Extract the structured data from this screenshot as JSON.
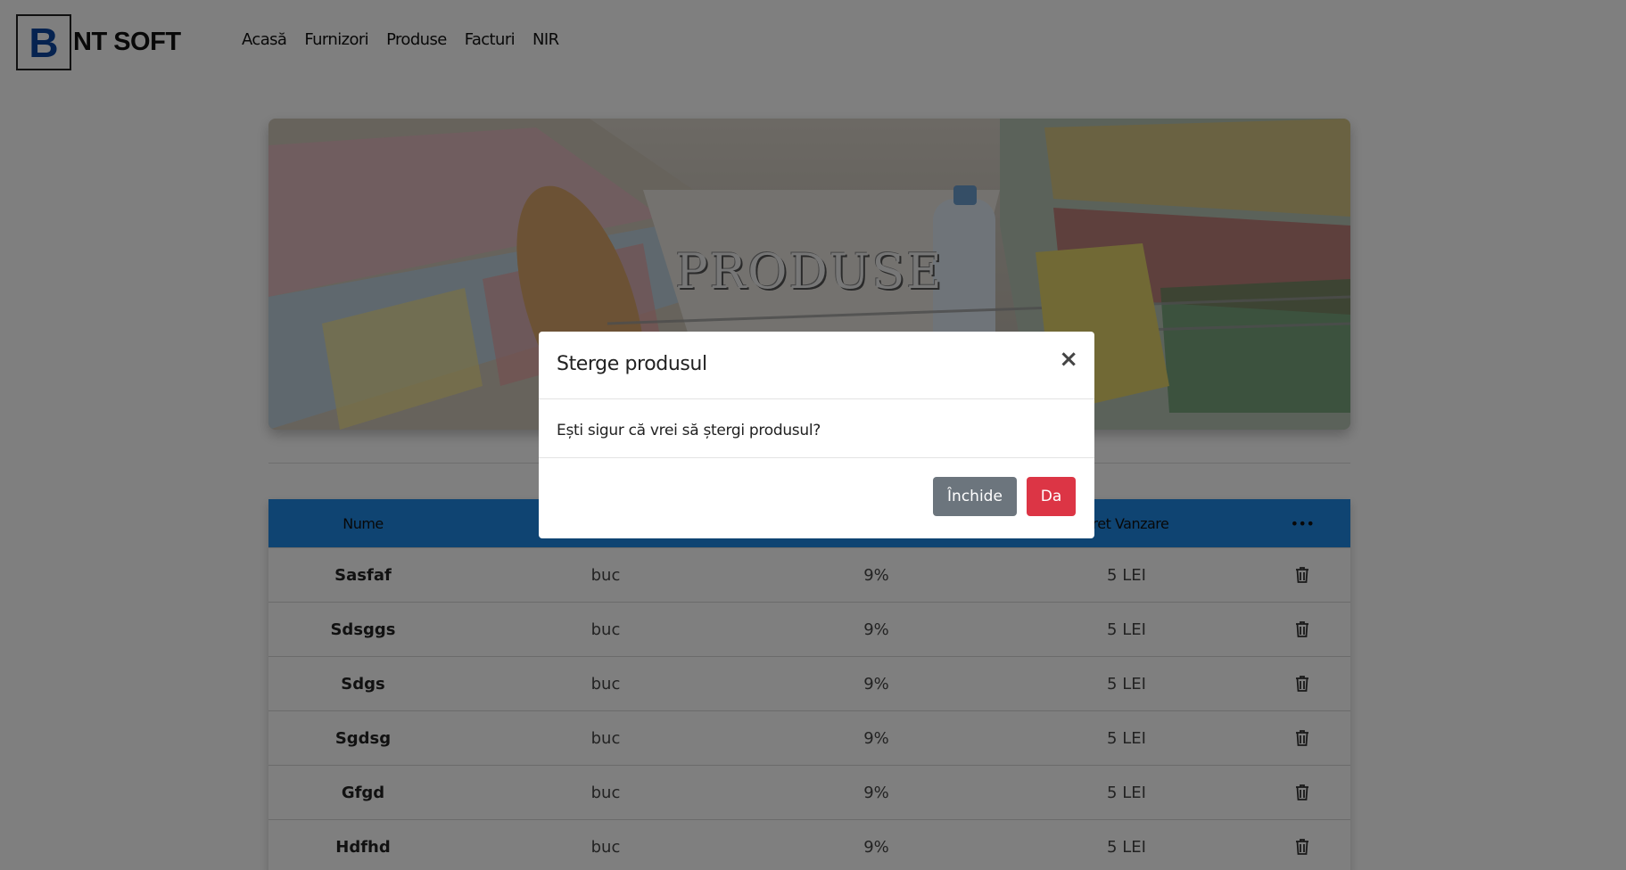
{
  "brand": {
    "letter": "B",
    "name": "NT SOFT"
  },
  "nav": [
    "Acasă",
    "Furnizori",
    "Produse",
    "Facturi",
    "NIR"
  ],
  "hero": {
    "title": "PRODUSE"
  },
  "table": {
    "headers": [
      "Nume",
      "",
      "",
      "Pret Vanzare",
      "•••"
    ],
    "rows": [
      {
        "name": "Sasfaf",
        "unit": "buc",
        "vat": "9%",
        "price": "5 LEI"
      },
      {
        "name": "Sdsggs",
        "unit": "buc",
        "vat": "9%",
        "price": "5 LEI"
      },
      {
        "name": "Sdgs",
        "unit": "buc",
        "vat": "9%",
        "price": "5 LEI"
      },
      {
        "name": "Sgdsg",
        "unit": "buc",
        "vat": "9%",
        "price": "5 LEI"
      },
      {
        "name": "Gfgd",
        "unit": "buc",
        "vat": "9%",
        "price": "5 LEI"
      },
      {
        "name": "Hdfhd",
        "unit": "buc",
        "vat": "9%",
        "price": "5 LEI"
      }
    ]
  },
  "modal": {
    "title": "Sterge produsul",
    "close": "×",
    "message": "Ești sigur că vrei să ștergi produsul?",
    "cancel_label": "Închide",
    "confirm_label": "Da"
  },
  "colors": {
    "header": "#1e88e5",
    "danger": "#dc3545",
    "secondary": "#6c757d",
    "brand_blue": "#0d47a1"
  },
  "icons": {
    "row_action": "trash-icon",
    "modal_close": "close-icon"
  }
}
